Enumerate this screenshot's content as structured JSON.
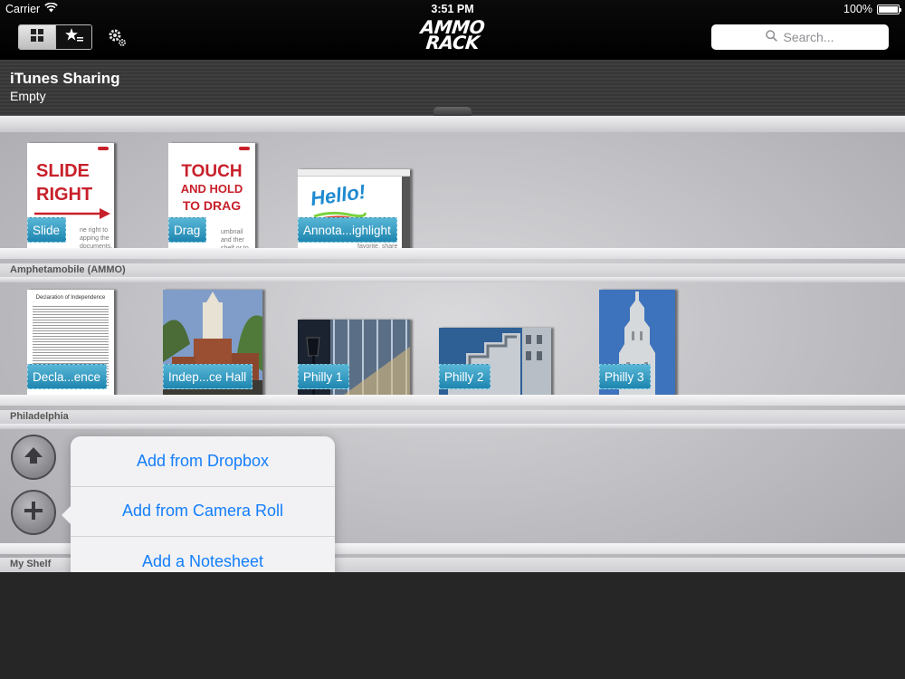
{
  "status_bar": {
    "carrier": "Carrier",
    "time": "3:51 PM",
    "battery": "100%"
  },
  "nav": {
    "logo_line1": "AMMO",
    "logo_line2": "RACK",
    "search_placeholder": "Search..."
  },
  "sharing": {
    "title": "iTunes Sharing",
    "subtitle": "Empty"
  },
  "shelves": [
    {
      "label": "Amphetamobile (AMMO)",
      "items": [
        {
          "title": "Slide",
          "thumb_text": [
            "SLIDE",
            "RIGHT"
          ],
          "caption": "ne right to apping the documents."
        },
        {
          "title": "Drag",
          "thumb_text": [
            "TOUCH",
            "AND HOLD",
            "TO DRAG"
          ],
          "caption": "umbnail and ther shelf or to delete."
        },
        {
          "title": "Annota...ighlight",
          "thumb_text": [
            "Hello!"
          ],
          "caption": "mark as favorite, share and print."
        }
      ]
    },
    {
      "label": "Philadelphia",
      "items": [
        {
          "title": "Decla...ence",
          "thumb_text": [
            "Declaration of Independence"
          ]
        },
        {
          "title": "Indep...ce Hall"
        },
        {
          "title": "Philly 1"
        },
        {
          "title": "Philly 2"
        },
        {
          "title": "Philly 3"
        }
      ]
    },
    {
      "label": "My Shelf",
      "items": []
    }
  ],
  "menu": {
    "options": [
      "Add from Dropbox",
      "Add from Camera Roll",
      "Add a Notesheet"
    ]
  },
  "colors": {
    "accent": "#147efb",
    "tag": "#2a94bd",
    "red_text": "#c8202a"
  },
  "icons": [
    "wifi-icon",
    "battery-icon",
    "grid-icon",
    "star-list-icon",
    "gear-icon",
    "search-icon",
    "up-arrow-icon",
    "plus-icon"
  ]
}
